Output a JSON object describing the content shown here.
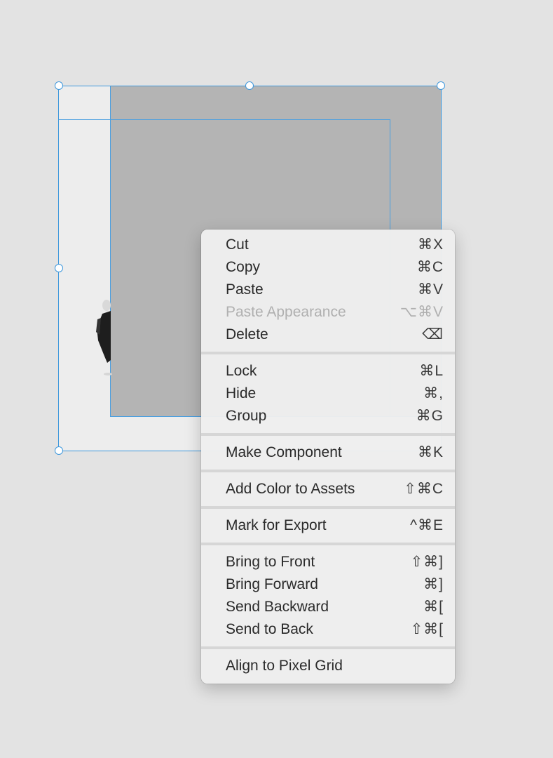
{
  "context_menu": {
    "groups": [
      [
        {
          "label": "Cut",
          "shortcut": "⌘X",
          "enabled": true
        },
        {
          "label": "Copy",
          "shortcut": "⌘C",
          "enabled": true
        },
        {
          "label": "Paste",
          "shortcut": "⌘V",
          "enabled": true
        },
        {
          "label": "Paste Appearance",
          "shortcut": "⌥⌘V",
          "enabled": false
        },
        {
          "label": "Delete",
          "shortcut": "⌫",
          "enabled": true
        }
      ],
      [
        {
          "label": "Lock",
          "shortcut": "⌘L",
          "enabled": true
        },
        {
          "label": "Hide",
          "shortcut": "⌘,",
          "enabled": true
        },
        {
          "label": "Group",
          "shortcut": "⌘G",
          "enabled": true
        }
      ],
      [
        {
          "label": "Make Component",
          "shortcut": "⌘K",
          "enabled": true
        }
      ],
      [
        {
          "label": "Add Color to Assets",
          "shortcut": "⇧⌘C",
          "enabled": true
        }
      ],
      [
        {
          "label": "Mark for Export",
          "shortcut": "^⌘E",
          "enabled": true
        }
      ],
      [
        {
          "label": "Bring to Front",
          "shortcut": "⇧⌘]",
          "enabled": true
        },
        {
          "label": "Bring Forward",
          "shortcut": "⌘]",
          "enabled": true
        },
        {
          "label": "Send Backward",
          "shortcut": "⌘[",
          "enabled": true
        },
        {
          "label": "Send to Back",
          "shortcut": "⇧⌘[",
          "enabled": true
        }
      ],
      [
        {
          "label": "Align to Pixel Grid",
          "shortcut": "",
          "enabled": true
        }
      ]
    ]
  },
  "colors": {
    "canvas_background": "#e3e3e3",
    "selection_accent": "#3d97dc",
    "shape_fill": "#b4b4b4",
    "disabled_text": "#b0b0b0"
  }
}
